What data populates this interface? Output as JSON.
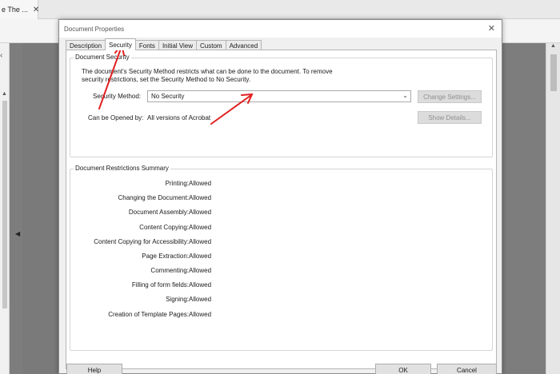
{
  "app": {
    "tab_title": "e The ...",
    "tab_close": "✕",
    "sidebar_mark": "‹",
    "collapse_glyph": "◀"
  },
  "dialog": {
    "title": "Document Properties",
    "close_glyph": "✕",
    "tabs": [
      {
        "label": "Description"
      },
      {
        "label": "Security",
        "active": true
      },
      {
        "label": "Fonts"
      },
      {
        "label": "Initial View"
      },
      {
        "label": "Custom"
      },
      {
        "label": "Advanced"
      }
    ],
    "security": {
      "group_title": "Document Security",
      "description": "The document's Security Method restricts what can be done to the document. To remove security restrictions, set the Security Method to No Security.",
      "method_label": "Security Method:",
      "method_value": "No Security",
      "change_settings_label": "Change Settings...",
      "opened_by_label": "Can be Opened by:",
      "opened_by_value": "All versions of Acrobat",
      "show_details_label": "Show Details..."
    },
    "restrictions": {
      "group_title": "Document Restrictions Summary",
      "rows": [
        {
          "label": "Printing:",
          "value": "Allowed"
        },
        {
          "label": "Changing the Document:",
          "value": "Allowed"
        },
        {
          "label": "Document Assembly:",
          "value": "Allowed"
        },
        {
          "label": "Content Copying:",
          "value": "Allowed"
        },
        {
          "label": "Content Copying for Accessibility:",
          "value": "Allowed"
        },
        {
          "label": "Page Extraction:",
          "value": "Allowed"
        },
        {
          "label": "Commenting:",
          "value": "Allowed"
        },
        {
          "label": "Filling of form fields:",
          "value": "Allowed"
        },
        {
          "label": "Signing:",
          "value": "Allowed"
        },
        {
          "label": "Creation of Template Pages:",
          "value": "Allowed"
        }
      ]
    },
    "buttons": {
      "help": "Help",
      "ok": "OK",
      "cancel": "Cancel"
    }
  },
  "colors": {
    "annotation_arrow": "#e02020",
    "dialog_bg": "#f0f0f0",
    "backdrop": "#7a7a7a"
  }
}
